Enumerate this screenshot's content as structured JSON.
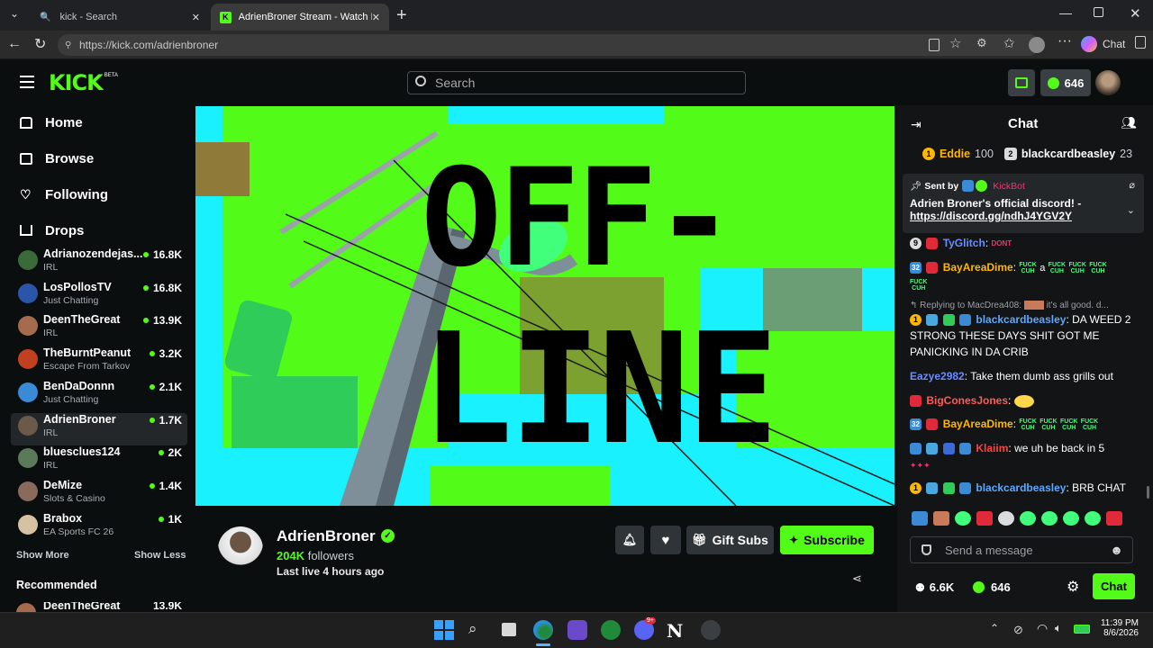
{
  "browser": {
    "tabs": [
      {
        "title": "kick - Search"
      },
      {
        "title": "AdrienBroner Stream - Watch Live"
      }
    ],
    "url": "https://kick.com/adrienbroner",
    "copilot_label": "Chat"
  },
  "header": {
    "logo_text": "KICK",
    "beta_tag": "BETA",
    "search_placeholder": "Search",
    "kicks_balance": "646"
  },
  "sidebar": {
    "nav": [
      {
        "label": "Home",
        "icon": "home-icon"
      },
      {
        "label": "Browse",
        "icon": "browse-icon"
      },
      {
        "label": "Following",
        "icon": "heart-icon"
      },
      {
        "label": "Drops",
        "icon": "drops-icon"
      }
    ],
    "channels": [
      {
        "name": "Adrianozendejas...",
        "category": "IRL",
        "viewers": "16.8K",
        "color": "#3a6a3a"
      },
      {
        "name": "LosPollosTV",
        "category": "Just Chatting",
        "viewers": "16.8K",
        "color": "#2b55a8"
      },
      {
        "name": "DeenTheGreat",
        "category": "IRL",
        "viewers": "13.9K",
        "color": "#a56b4c"
      },
      {
        "name": "TheBurntPeanut",
        "category": "Escape From Tarkov",
        "viewers": "3.2K",
        "color": "#c04020"
      },
      {
        "name": "BenDaDonnn",
        "category": "Just Chatting",
        "viewers": "2.1K",
        "color": "#3a8ad6"
      },
      {
        "name": "AdrienBroner",
        "category": "IRL",
        "viewers": "1.7K",
        "color": "#6b5a4a"
      },
      {
        "name": "bluesclues124",
        "category": "IRL",
        "viewers": "2K",
        "color": "#5a7a5a"
      },
      {
        "name": "DeMize",
        "category": "Slots & Casino",
        "viewers": "1.4K",
        "color": "#8a6a5a"
      },
      {
        "name": "Brabox",
        "category": "EA Sports FC 26",
        "viewers": "1K",
        "color": "#d6c2a0"
      }
    ],
    "show_more": "Show More",
    "show_less": "Show Less",
    "recommended_heading": "Recommended",
    "recommended_partial": {
      "name": "DeenTheGreat",
      "viewers": "13.9K"
    }
  },
  "player": {
    "offline_line1": "OFF-",
    "offline_line2": "LINE"
  },
  "channel": {
    "name": "AdrienBroner",
    "followers_count": "204K",
    "followers_label": "followers",
    "last_live": "Last live 4 hours ago",
    "gift_subs_label": "Gift Subs",
    "subscribe_label": "Subscribe"
  },
  "chat": {
    "title": "Chat",
    "leaderboard": [
      {
        "rank": "1",
        "name": "Eddie",
        "score": "100"
      },
      {
        "rank": "2",
        "name": "blackcardbeasley",
        "score": "23"
      }
    ],
    "pinned": {
      "sent_by_label": "Sent by",
      "sender": "KickBot",
      "message": "Adrien Broner's official discord! -",
      "link": "https://discord.gg/ndhJ4YGV2Y"
    },
    "messages": [
      {
        "badge": "9",
        "user": "TyGlitch",
        "user_color": "#6b8cff",
        "text": "",
        "emote": "DONT"
      },
      {
        "badge": "32",
        "user": "BayAreaDime",
        "user_color": "#ffb800",
        "text": "",
        "emote": "FUCK CUH"
      },
      {
        "reply_to": "Replying to MacDrea408:",
        "reply_text": "it's all good. d..."
      },
      {
        "badge": "1",
        "user": "blackcardbeasley",
        "user_color": "#5aa8ff",
        "text": "DA WEED 2 STRONG THESE DAYS SHIT GOT ME PANICKING IN DA CRIB"
      },
      {
        "user": "Eazye2982",
        "user_color": "#6b8cff",
        "text": "Take them dumb ass grills out"
      },
      {
        "user": "BigConesJones",
        "user_color": "#ff5a5a",
        "text": ""
      },
      {
        "badge": "32",
        "user": "BayAreaDime",
        "user_color": "#ffb800",
        "text": ""
      },
      {
        "user": "Klaiim",
        "user_color": "#ff4040",
        "text": "we uh be back in 5"
      },
      {
        "badge": "1",
        "user": "blackcardbeasley",
        "user_color": "#5aa8ff",
        "text": "BRB CHAT"
      }
    ],
    "emote_fuck": "FUCK",
    "emote_cuh": "CUH",
    "emote_a": "a",
    "input_placeholder": "Send a message",
    "viewer_count": "6.6K",
    "kicks": "646",
    "send_label": "Chat"
  },
  "taskbar": {
    "time": "11:39 PM",
    "date": "8/6/2026",
    "badge_count": "9+"
  },
  "colors": {
    "kick_green": "#53fc18",
    "cyan": "#19f1ff",
    "bg": "#0b0e0f"
  }
}
